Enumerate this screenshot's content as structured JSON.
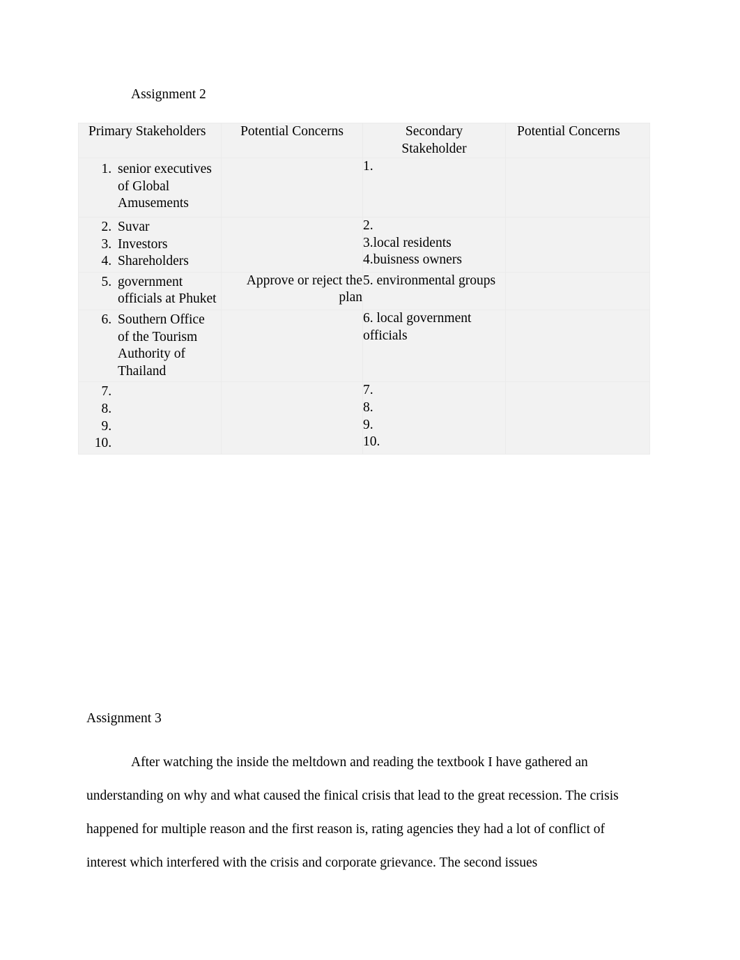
{
  "document": {
    "assignment2_heading": "Assignment 2",
    "assignment3_heading": "Assignment 3",
    "table": {
      "headers": [
        "Primary Stakeholders",
        "Potential Concerns",
        "Secondary Stakeholder",
        "Potential Concerns"
      ],
      "secondary_header_line1": "Secondary",
      "secondary_header_line2": "Stakeholder",
      "rows": [
        {
          "primary_items": [
            "senior executives of Global Amusements"
          ],
          "primary_concerns": "",
          "secondary_items": [
            "1."
          ],
          "secondary_concerns": ""
        },
        {
          "primary_items": [
            "Suvar",
            "Investors",
            "Shareholders"
          ],
          "primary_concerns": "",
          "secondary_items": [
            "2.",
            "3.local residents",
            "4.buisness owners"
          ],
          "secondary_concerns": ""
        },
        {
          "primary_items": [
            " government officials at Phuket"
          ],
          "primary_concerns": "Approve or reject the plan",
          "secondary_items": [
            "5. environmental groups"
          ],
          "secondary_concerns": ""
        },
        {
          "primary_items": [
            "Southern Office of the Tourism Authority of Thailand"
          ],
          "primary_concerns": "",
          "secondary_items": [
            "6. local government officials"
          ],
          "secondary_concerns": ""
        },
        {
          "primary_items": [
            "",
            "",
            "",
            ""
          ],
          "primary_concerns": "",
          "secondary_items": [
            "7.",
            "8.",
            "9.",
            "10."
          ],
          "secondary_concerns": ""
        }
      ]
    },
    "paragraph": "After watching the inside the meltdown and reading the textbook I have gathered an understanding on why and what caused the finical crisis that lead to the great recession. The crisis happened for multiple reason and the first reason is, rating agencies they had a lot of conflict of interest which interfered with the crisis and corporate grievance. The second issues"
  }
}
